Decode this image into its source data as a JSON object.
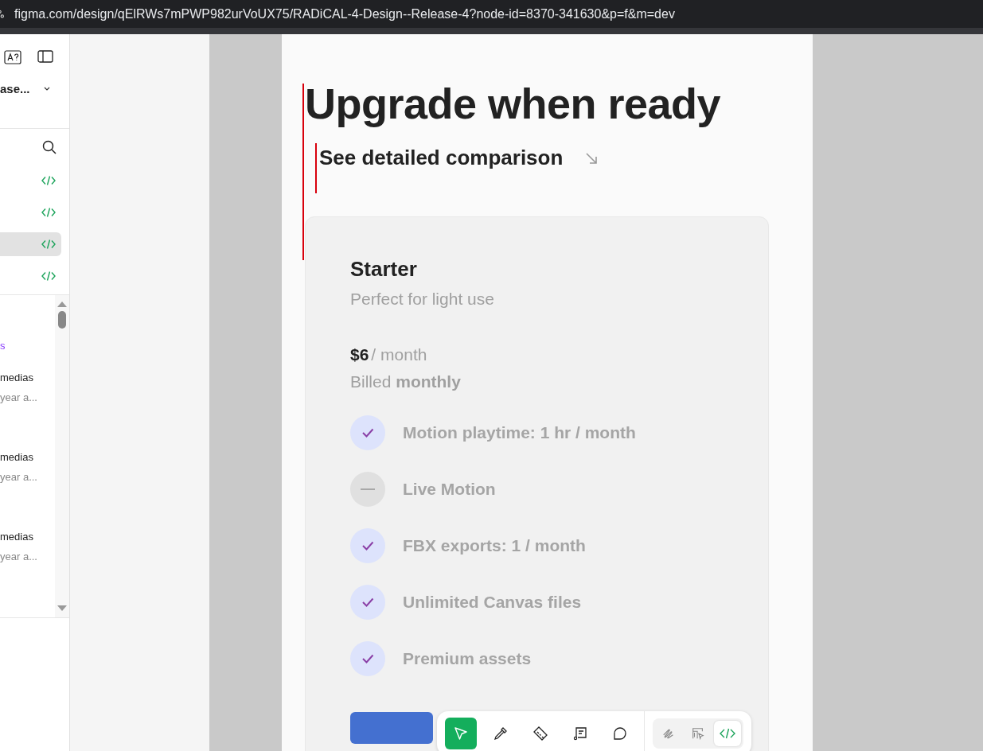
{
  "address_bar": {
    "url": "figma.com/design/qElRWs7mPWP982urVoUX75/RADiCAL-4-Design--Release-4?node-id=8370-341630&p=f&m=dev"
  },
  "sidebar": {
    "file_name": "ase...",
    "code_items": [
      {
        "selected": false
      },
      {
        "selected": false
      },
      {
        "selected": true
      },
      {
        "selected": false
      }
    ],
    "section_label": "s",
    "comments": [
      {
        "title": "medias",
        "time": "year a..."
      },
      {
        "title": "medias",
        "time": "year a..."
      },
      {
        "title": "medias",
        "time": "year a..."
      }
    ]
  },
  "frame": {
    "title": "Upgrade when ready",
    "comparison_link": "See detailed comparison",
    "plan": {
      "name": "Starter",
      "subtitle": "Perfect for light use",
      "price": "$6",
      "period": "/ month",
      "billing": "Billed **monthly**",
      "features": [
        {
          "label": "Motion playtime: 1 hr / month",
          "included": true
        },
        {
          "label": "Live Motion",
          "included": false
        },
        {
          "label": "FBX exports: 1  / month",
          "included": true
        },
        {
          "label": "Unlimited Canvas files",
          "included": true
        },
        {
          "label": "Premium assets",
          "included": true
        }
      ]
    }
  },
  "toolbar": {
    "tools": [
      {
        "kind": "move",
        "selected": true
      },
      {
        "kind": "eyedropper",
        "selected": false
      },
      {
        "kind": "ruler",
        "selected": false
      },
      {
        "kind": "annotate",
        "selected": false
      },
      {
        "kind": "comment",
        "selected": false
      }
    ],
    "modes": [
      {
        "kind": "draw",
        "selected": false
      },
      {
        "kind": "design",
        "selected": false
      },
      {
        "kind": "dev",
        "selected": true
      }
    ]
  }
}
